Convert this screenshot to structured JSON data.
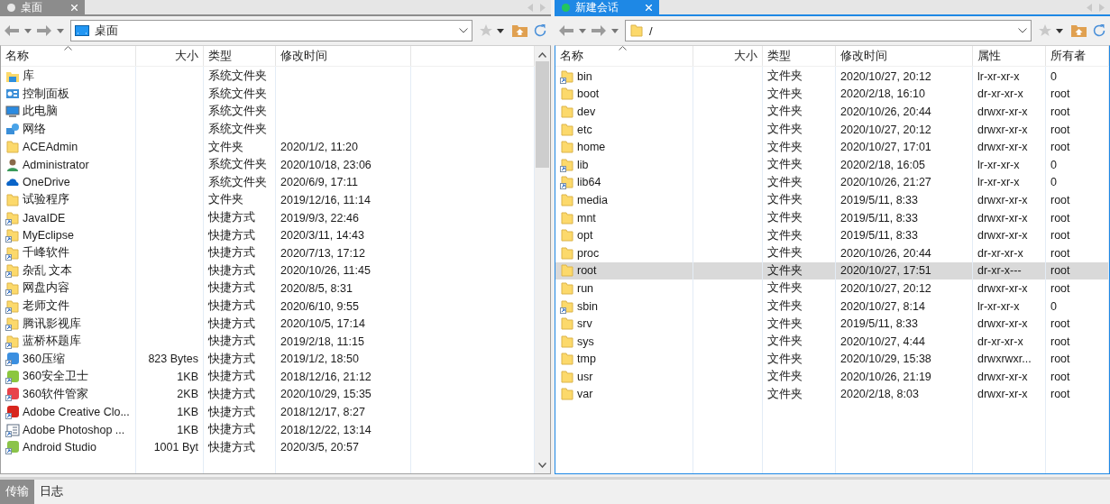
{
  "panes": [
    {
      "tab": {
        "label": "桌面",
        "selected": false,
        "connected": false
      },
      "address": {
        "kind": "desktop",
        "text": "桌面"
      },
      "columns": [
        "名称",
        "大小",
        "类型",
        "修改时间",
        ""
      ],
      "rows": [
        {
          "kind": "library",
          "selected": false,
          "cells": [
            "库",
            "",
            "系统文件夹",
            ""
          ]
        },
        {
          "kind": "control-panel",
          "selected": false,
          "cells": [
            "控制面板",
            "",
            "系统文件夹",
            ""
          ]
        },
        {
          "kind": "computer",
          "selected": false,
          "cells": [
            "此电脑",
            "",
            "系统文件夹",
            ""
          ]
        },
        {
          "kind": "network",
          "selected": false,
          "cells": [
            "网络",
            "",
            "系统文件夹",
            ""
          ]
        },
        {
          "kind": "folder",
          "selected": false,
          "cells": [
            "ACEAdmin",
            "",
            "文件夹",
            "2020/1/2, 11:20"
          ]
        },
        {
          "kind": "user",
          "selected": false,
          "cells": [
            "Administrator",
            "",
            "系统文件夹",
            "2020/10/18, 23:06"
          ]
        },
        {
          "kind": "cloud",
          "selected": false,
          "cells": [
            "OneDrive",
            "",
            "系统文件夹",
            "2020/6/9, 17:11"
          ]
        },
        {
          "kind": "folder",
          "selected": false,
          "cells": [
            "试验程序",
            "",
            "文件夹",
            "2019/12/16, 11:14"
          ]
        },
        {
          "kind": "folder-link",
          "selected": false,
          "cells": [
            "JavaIDE",
            "",
            "快捷方式",
            "2019/9/3, 22:46"
          ]
        },
        {
          "kind": "folder-link",
          "selected": false,
          "cells": [
            "MyEclipse",
            "",
            "快捷方式",
            "2020/3/11, 14:43"
          ]
        },
        {
          "kind": "folder-link",
          "selected": false,
          "cells": [
            "千峰软件",
            "",
            "快捷方式",
            "2020/7/13, 17:12"
          ]
        },
        {
          "kind": "folder-link",
          "selected": false,
          "cells": [
            "杂乱 文本",
            "",
            "快捷方式",
            "2020/10/26, 11:45"
          ]
        },
        {
          "kind": "folder-link",
          "selected": false,
          "cells": [
            "网盘内容",
            "",
            "快捷方式",
            "2020/8/5, 8:31"
          ]
        },
        {
          "kind": "folder-link",
          "selected": false,
          "cells": [
            "老师文件",
            "",
            "快捷方式",
            "2020/6/10, 9:55"
          ]
        },
        {
          "kind": "folder-link",
          "selected": false,
          "cells": [
            "腾讯影视库",
            "",
            "快捷方式",
            "2020/10/5, 17:14"
          ]
        },
        {
          "kind": "folder-link",
          "selected": false,
          "cells": [
            "蓝桥杯题库",
            "",
            "快捷方式",
            "2019/2/18, 11:15"
          ]
        },
        {
          "kind": "app",
          "color": "#3b8fe0",
          "selected": false,
          "cells": [
            "360压缩",
            "823 Bytes",
            "快捷方式",
            "2019/1/2, 18:50"
          ]
        },
        {
          "kind": "app",
          "color": "#8cc63f",
          "selected": false,
          "cells": [
            "360安全卫士",
            "1KB",
            "快捷方式",
            "2018/12/16, 21:12"
          ]
        },
        {
          "kind": "app",
          "color": "#e8434b",
          "selected": false,
          "cells": [
            "360软件管家",
            "2KB",
            "快捷方式",
            "2020/10/29, 15:35"
          ]
        },
        {
          "kind": "app",
          "color": "#d7261e",
          "selected": false,
          "cells": [
            "Adobe Creative Clo...",
            "1KB",
            "快捷方式",
            "2018/12/17, 8:27"
          ]
        },
        {
          "kind": "document-link",
          "selected": false,
          "cells": [
            "Adobe Photoshop ...",
            "1KB",
            "快捷方式",
            "2018/12/22, 13:14"
          ]
        },
        {
          "kind": "app",
          "color": "#8bc34a",
          "selected": false,
          "cells": [
            "Android Studio",
            "1001 Byt",
            "快捷方式",
            "2020/3/5, 20:57"
          ]
        }
      ]
    },
    {
      "tab": {
        "label": "新建会话",
        "selected": true,
        "connected": true
      },
      "address": {
        "kind": "folder",
        "text": "/"
      },
      "columns": [
        "名称",
        "大小",
        "类型",
        "修改时间",
        "属性",
        "所有者"
      ],
      "rows": [
        {
          "kind": "folder-link",
          "selected": false,
          "cells": [
            "bin",
            "",
            "文件夹",
            "2020/10/27, 20:12",
            "lr-xr-xr-x",
            "0"
          ]
        },
        {
          "kind": "folder",
          "selected": false,
          "cells": [
            "boot",
            "",
            "文件夹",
            "2020/2/18, 16:10",
            "dr-xr-xr-x",
            "root"
          ]
        },
        {
          "kind": "folder",
          "selected": false,
          "cells": [
            "dev",
            "",
            "文件夹",
            "2020/10/26, 20:44",
            "drwxr-xr-x",
            "root"
          ]
        },
        {
          "kind": "folder",
          "selected": false,
          "cells": [
            "etc",
            "",
            "文件夹",
            "2020/10/27, 20:12",
            "drwxr-xr-x",
            "root"
          ]
        },
        {
          "kind": "folder",
          "selected": false,
          "cells": [
            "home",
            "",
            "文件夹",
            "2020/10/27, 17:01",
            "drwxr-xr-x",
            "root"
          ]
        },
        {
          "kind": "folder-link",
          "selected": false,
          "cells": [
            "lib",
            "",
            "文件夹",
            "2020/2/18, 16:05",
            "lr-xr-xr-x",
            "0"
          ]
        },
        {
          "kind": "folder-link",
          "selected": false,
          "cells": [
            "lib64",
            "",
            "文件夹",
            "2020/10/26, 21:27",
            "lr-xr-xr-x",
            "0"
          ]
        },
        {
          "kind": "folder",
          "selected": false,
          "cells": [
            "media",
            "",
            "文件夹",
            "2019/5/11, 8:33",
            "drwxr-xr-x",
            "root"
          ]
        },
        {
          "kind": "folder",
          "selected": false,
          "cells": [
            "mnt",
            "",
            "文件夹",
            "2019/5/11, 8:33",
            "drwxr-xr-x",
            "root"
          ]
        },
        {
          "kind": "folder",
          "selected": false,
          "cells": [
            "opt",
            "",
            "文件夹",
            "2019/5/11, 8:33",
            "drwxr-xr-x",
            "root"
          ]
        },
        {
          "kind": "folder",
          "selected": false,
          "cells": [
            "proc",
            "",
            "文件夹",
            "2020/10/26, 20:44",
            "dr-xr-xr-x",
            "root"
          ]
        },
        {
          "kind": "folder",
          "selected": true,
          "cells": [
            "root",
            "",
            "文件夹",
            "2020/10/27, 17:51",
            "dr-xr-x---",
            "root"
          ]
        },
        {
          "kind": "folder",
          "selected": false,
          "cells": [
            "run",
            "",
            "文件夹",
            "2020/10/27, 20:12",
            "drwxr-xr-x",
            "root"
          ]
        },
        {
          "kind": "folder-link",
          "selected": false,
          "cells": [
            "sbin",
            "",
            "文件夹",
            "2020/10/27, 8:14",
            "lr-xr-xr-x",
            "0"
          ]
        },
        {
          "kind": "folder",
          "selected": false,
          "cells": [
            "srv",
            "",
            "文件夹",
            "2019/5/11, 8:33",
            "drwxr-xr-x",
            "root"
          ]
        },
        {
          "kind": "folder",
          "selected": false,
          "cells": [
            "sys",
            "",
            "文件夹",
            "2020/10/27, 4:44",
            "dr-xr-xr-x",
            "root"
          ]
        },
        {
          "kind": "folder",
          "selected": false,
          "cells": [
            "tmp",
            "",
            "文件夹",
            "2020/10/29, 15:38",
            "drwxrwxr...",
            "root"
          ]
        },
        {
          "kind": "folder",
          "selected": false,
          "cells": [
            "usr",
            "",
            "文件夹",
            "2020/10/26, 21:19",
            "drwxr-xr-x",
            "root"
          ]
        },
        {
          "kind": "folder",
          "selected": false,
          "cells": [
            "var",
            "",
            "文件夹",
            "2020/2/18, 8:03",
            "drwxr-xr-x",
            "root"
          ]
        }
      ]
    }
  ],
  "bottom_tabs": [
    {
      "label": "传输",
      "selected": true
    },
    {
      "label": "日志",
      "selected": false
    }
  ]
}
